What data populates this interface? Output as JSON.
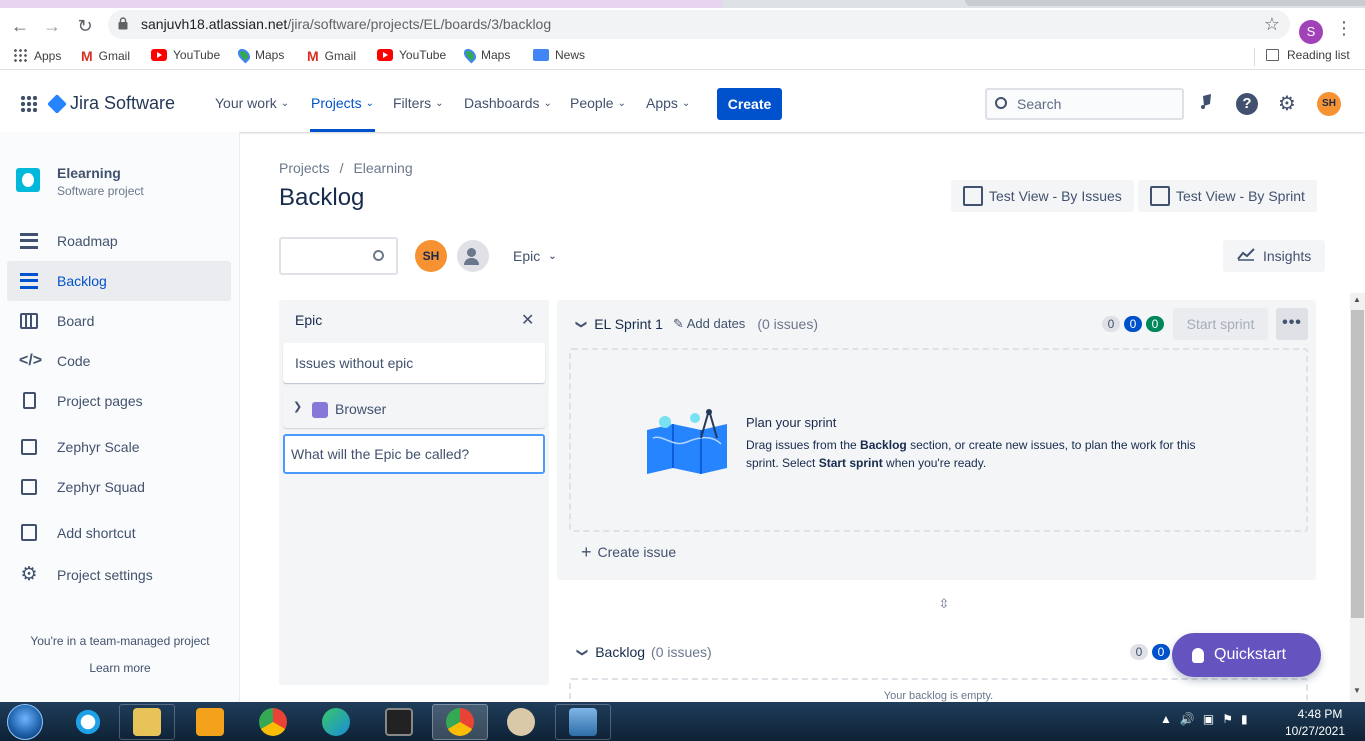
{
  "browser": {
    "url_host": "sanjuvh18.atlassian.net",
    "url_path": "/jira/software/projects/EL/boards/3/backlog",
    "profile_initial": "S",
    "bookmarks": [
      "Apps",
      "Gmail",
      "YouTube",
      "Maps",
      "Gmail",
      "YouTube",
      "Maps",
      "News"
    ],
    "reading_list": "Reading list"
  },
  "jira_nav": {
    "product": "Jira Software",
    "items": [
      "Your work",
      "Projects",
      "Filters",
      "Dashboards",
      "People",
      "Apps"
    ],
    "active_item": "Projects",
    "create_label": "Create",
    "search_placeholder": "Search",
    "user_initials": "SH"
  },
  "sidebar": {
    "project_name": "Elearning",
    "project_type": "Software project",
    "items": [
      {
        "label": "Roadmap",
        "icon": "roadmap-icon"
      },
      {
        "label": "Backlog",
        "icon": "backlog-icon",
        "active": true
      },
      {
        "label": "Board",
        "icon": "board-icon"
      },
      {
        "label": "Code",
        "icon": "code-icon"
      },
      {
        "label": "Project pages",
        "icon": "page-icon"
      },
      {
        "label": "Zephyr Scale",
        "icon": "zephyr-scale-icon"
      },
      {
        "label": "Zephyr Squad",
        "icon": "zephyr-squad-icon"
      },
      {
        "label": "Add shortcut",
        "icon": "add-shortcut-icon"
      },
      {
        "label": "Project settings",
        "icon": "gear-icon"
      }
    ],
    "team_note": "You're in a team-managed project",
    "learn_more": "Learn more"
  },
  "main": {
    "breadcrumb": [
      "Projects",
      "Elearning"
    ],
    "title": "Backlog",
    "views": [
      "Test View - By Issues",
      "Test View - By Sprint"
    ],
    "insights": "Insights",
    "avatar_initials": "SH",
    "epic_filter": "Epic"
  },
  "epic_panel": {
    "title": "Epic",
    "issues_without_epic": "Issues without epic",
    "epics": [
      {
        "name": "Browser",
        "color": "#8777d9"
      }
    ],
    "new_epic_placeholder": "What will the Epic be called?"
  },
  "sprint": {
    "name": "EL Sprint 1",
    "add_dates": "Add dates",
    "issue_count": "(0 issues)",
    "counts": {
      "todo": "0",
      "in_progress": "0",
      "done": "0"
    },
    "start_label": "Start sprint",
    "more_label": "•••",
    "plan_title": "Plan your sprint",
    "plan_desc_1": "Drag issues from the ",
    "plan_desc_bold_1": "Backlog",
    "plan_desc_2": " section, or create new issues, to plan the work for this sprint. Select ",
    "plan_desc_bold_2": "Start sprint",
    "plan_desc_3": " when you're ready.",
    "create_issue": "Create issue"
  },
  "backlog": {
    "name": "Backlog",
    "issue_count": "(0 issues)",
    "counts": {
      "todo": "0",
      "in_progress": "0"
    },
    "empty_text": "Your backlog is empty."
  },
  "quickstart": "Quickstart",
  "taskbar": {
    "time": "4:48 PM",
    "date": "10/27/2021"
  }
}
